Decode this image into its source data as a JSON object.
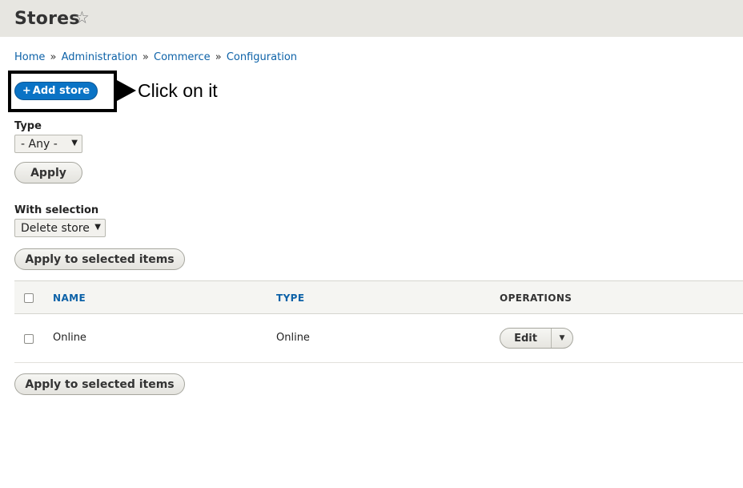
{
  "page": {
    "title": "Stores",
    "star_icon": "star-outline-icon"
  },
  "breadcrumb": {
    "items": [
      "Home",
      "Administration",
      "Commerce",
      "Configuration"
    ],
    "separator": "»"
  },
  "actions": {
    "add_store_label": "Add store",
    "add_store_plus": "+"
  },
  "annotation": {
    "text": "Click on it"
  },
  "filters": {
    "type_label": "Type",
    "type_selected": "- Any -",
    "apply_label": "Apply"
  },
  "bulk": {
    "with_selection_label": "With selection",
    "action_selected": "Delete store",
    "apply_selected_label": "Apply to selected items"
  },
  "table": {
    "columns": [
      "NAME",
      "TYPE",
      "OPERATIONS"
    ],
    "rows": [
      {
        "name": "Online",
        "type": "Online",
        "operation": "Edit"
      }
    ]
  },
  "colors": {
    "accent": "#0a73c5",
    "link": "#0d62a8",
    "header_bg": "#e7e6e1"
  }
}
